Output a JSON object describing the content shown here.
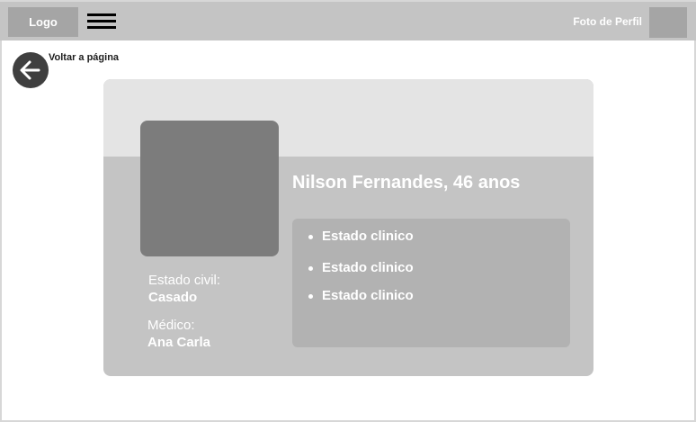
{
  "header": {
    "logo_label": "Logo",
    "menu_icon": "hamburger-menu-icon",
    "profile_label": "Foto de Perfil"
  },
  "navigation": {
    "back_label": "Voltar a página",
    "back_icon": "arrow-left-icon"
  },
  "patient": {
    "name_age": "Nilson Fernandes, 46 anos",
    "marital_status_label": "Estado civil:",
    "marital_status_value": "Casado",
    "doctor_label": "Médico:",
    "doctor_value": "Ana Carla",
    "clinical_states": [
      "Estado clinico",
      "Estado clinico",
      "Estado clinico"
    ]
  },
  "colors": {
    "topbar": "#c4c4c4",
    "placeholder": "#a5a5a5",
    "card": "#c4c4c4",
    "card_header": "#e4e4e4",
    "photo": "#7c7c7c",
    "status_box": "#b2b2b2",
    "back_button": "#3f3f3f"
  }
}
